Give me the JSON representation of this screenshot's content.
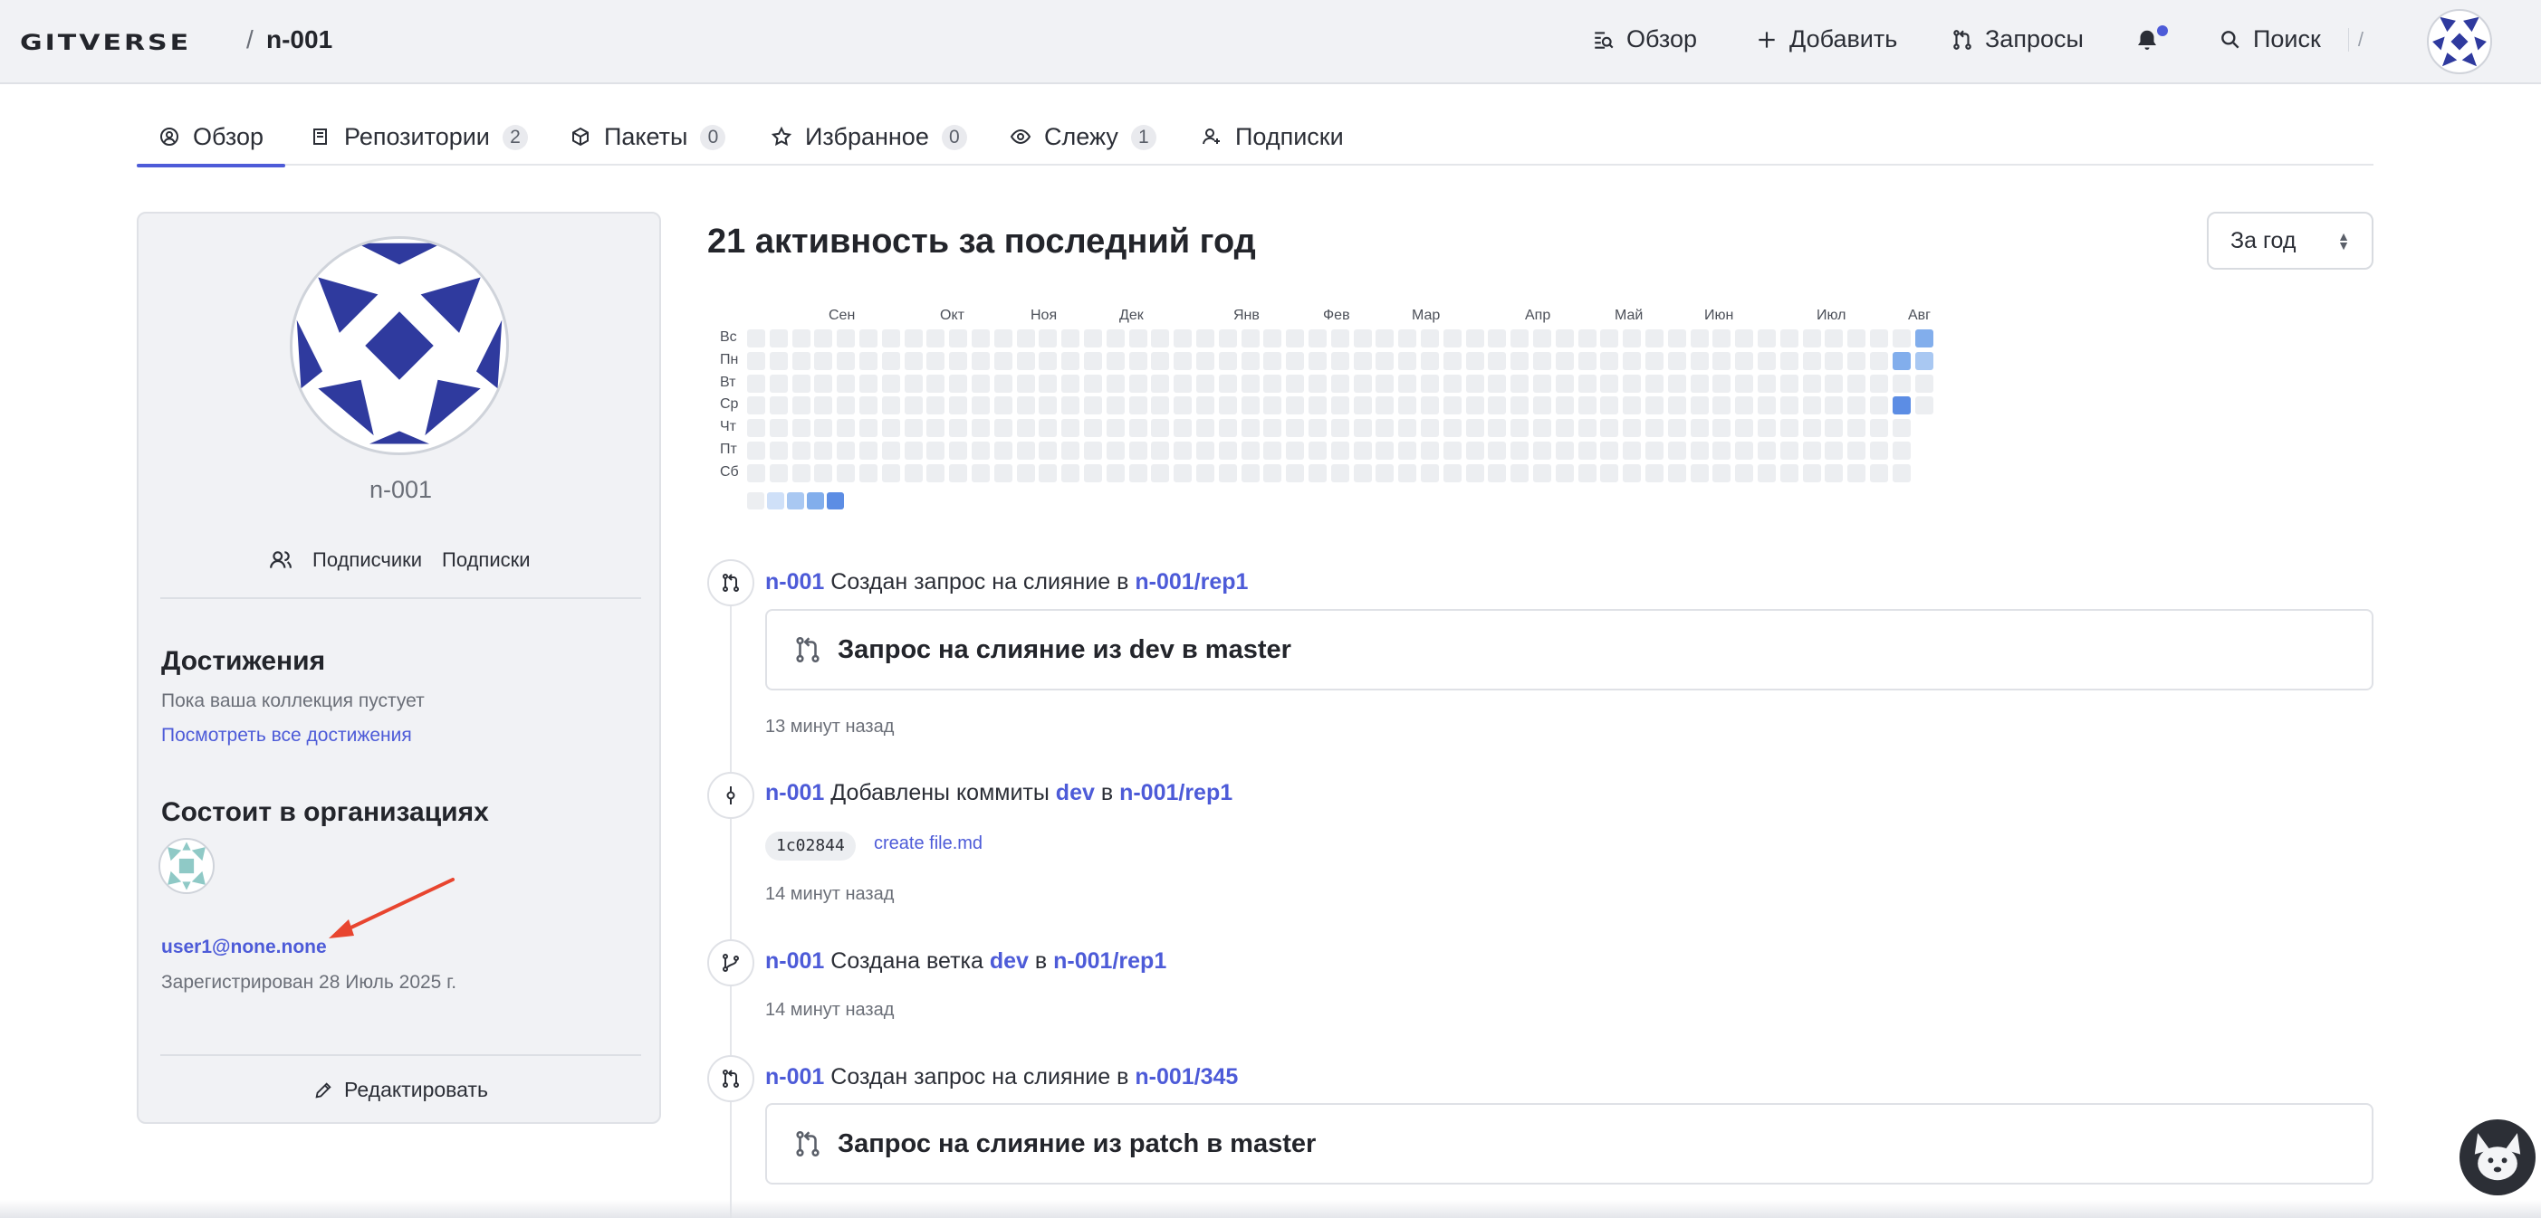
{
  "header": {
    "logo": "GITVERSE",
    "separator": "/",
    "username": "n-001",
    "nav": [
      {
        "label": "Обзор",
        "icon": "overview-icon"
      },
      {
        "label": "Добавить",
        "icon": "plus-icon"
      },
      {
        "label": "Запросы",
        "icon": "pull-request-icon"
      }
    ],
    "search_label": "Поиск",
    "search_shortcut": "/"
  },
  "tabs": [
    {
      "label": "Обзор",
      "icon": "user-circle-icon",
      "count": null
    },
    {
      "label": "Репозитории",
      "icon": "repo-icon",
      "count": "2"
    },
    {
      "label": "Пакеты",
      "icon": "package-icon",
      "count": "0"
    },
    {
      "label": "Избранное",
      "icon": "star-icon",
      "count": "0"
    },
    {
      "label": "Слежу",
      "icon": "eye-icon",
      "count": "1"
    },
    {
      "label": "Подписки",
      "icon": "user-plus-icon",
      "count": null
    }
  ],
  "sidebar": {
    "username": "n-001",
    "followers_label": "Подписчики",
    "following_label": "Подписки",
    "achievements_title": "Достижения",
    "achievements_empty": "Пока ваша коллекция пустует",
    "achievements_link": "Посмотреть все достижения",
    "orgs_title": "Состоит в организациях",
    "email": "user1@none.none",
    "registered": "Зарегистрирован 28 Июль 2025 г.",
    "edit_label": "Редактировать"
  },
  "activity": {
    "title": "21 активность за последний год",
    "period": "За год",
    "months": [
      "Сен",
      "Окт",
      "Ноя",
      "Дек",
      "Янв",
      "Фев",
      "Мар",
      "Апр",
      "Май",
      "Июн",
      "Июл",
      "Авг"
    ],
    "days": [
      "Вс",
      "Пн",
      "Вт",
      "Ср",
      "Чт",
      "Пт",
      "Сб"
    ],
    "weeks": 53,
    "active_cells": [
      {
        "week": 51,
        "day": 1,
        "level": 3
      },
      {
        "week": 51,
        "day": 3,
        "level": 4
      },
      {
        "week": 52,
        "day": 0,
        "level": 3
      },
      {
        "week": 52,
        "day": 1,
        "level": 2
      }
    ],
    "legend_levels": [
      0,
      1,
      2,
      3,
      4
    ],
    "colors": [
      "#eceef1",
      "#cfe0f8",
      "#a9c8f2",
      "#82aeec",
      "#5c8de4"
    ]
  },
  "feed": [
    {
      "user": "n-001",
      "action": "Создан запрос на слияние в",
      "repo": "n-001/rep1",
      "pr_title": "Запрос на слияние из dev в master",
      "time": "13 минут назад"
    },
    {
      "user": "n-001",
      "action": "Добавлены коммиты",
      "branch": "dev",
      "in": "в",
      "repo": "n-001/rep1",
      "sha": "1c02844",
      "commit_message": "create file.md",
      "time": "14 минут назад"
    },
    {
      "user": "n-001",
      "action": "Создана ветка",
      "branch": "dev",
      "in": "в",
      "repo": "n-001/rep1",
      "time": "14 минут назад"
    },
    {
      "user": "n-001",
      "action": "Создан запрос на слияние в",
      "repo": "n-001/345",
      "pr_title": "Запрос на слияние из patch в master"
    }
  ],
  "colors": {
    "accent": "#4d5bd8",
    "avatar_blue": "#2f3a9e",
    "org_teal": "#8fc9c6",
    "arrow_red": "#e8452f"
  }
}
